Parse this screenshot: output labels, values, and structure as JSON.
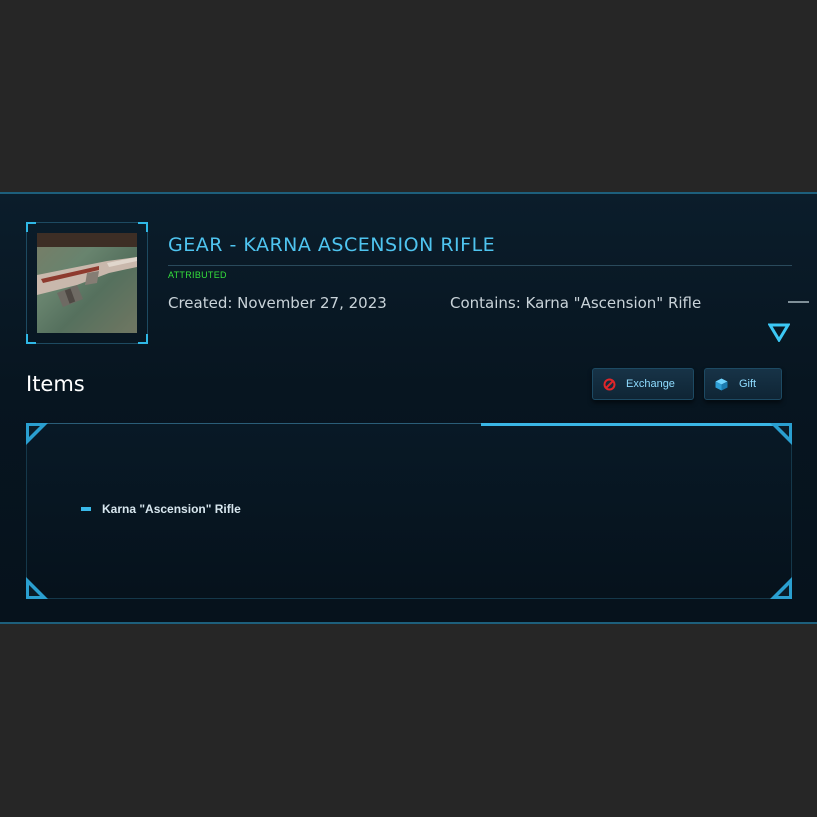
{
  "pledge": {
    "title": "GEAR - KARNA ASCENSION RIFLE",
    "status": "ATTRIBUTED",
    "created": "Created: November 27, 2023",
    "contains": "Contains: Karna \"Ascension\" Rifle"
  },
  "items_section": {
    "heading": "Items",
    "buttons": {
      "exchange_label": "Exchange",
      "gift_label": "Gift"
    },
    "items": [
      {
        "label": "Karna \"Ascension\" Rifle"
      }
    ]
  },
  "colors": {
    "accent": "#4fc4ef",
    "status_green": "#35e03b",
    "background": "#262626",
    "panel": "#071520"
  },
  "icons": {
    "expand": "chevron-down-triangle-icon",
    "exchange": "no-entry-icon",
    "gift": "gift-cube-icon"
  }
}
